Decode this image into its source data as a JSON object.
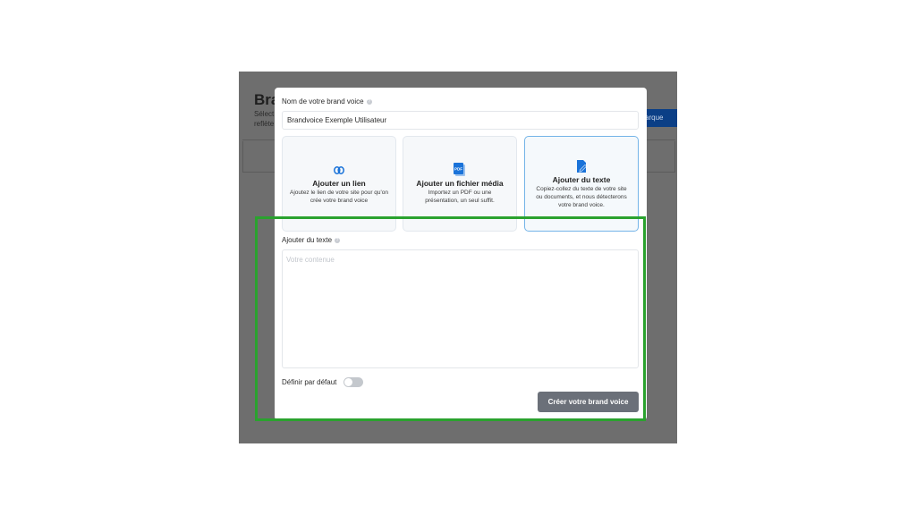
{
  "background": {
    "title": "Bra",
    "subtitle_line1": "Sélect",
    "subtitle_line2": "reflète",
    "button_label": "arque"
  },
  "modal": {
    "name_label": "Nom de votre brand voice",
    "name_value": "Brandvoice Exemple Utilisateur",
    "options": [
      {
        "title": "Ajouter un lien",
        "description": "Ajoutez le lien de votre site pour qu'on crée votre brand voice",
        "icon": "link-icon",
        "selected": false
      },
      {
        "title": "Ajouter un fichier média",
        "description": "Importez un PDF ou une présentation, un seul suffit.",
        "icon": "pdf-file-icon",
        "icon_text": "PDF",
        "selected": false
      },
      {
        "title": "Ajouter du texte",
        "description": "Copiez-collez du texte de votre site ou documents, et nous détecterons votre brand voice.",
        "icon": "edit-text-icon",
        "selected": true
      }
    ],
    "text_label": "Ajouter du texte",
    "text_placeholder": "Votre contenue",
    "default_label": "Définir par défaut",
    "default_toggle_on": false,
    "submit_label": "Créer votre brand voice",
    "info_glyph": "?"
  },
  "colors": {
    "accent": "#1a73d9",
    "highlight": "#2aa22e",
    "submit": "#6b7079",
    "selected_border": "#74b4e8"
  }
}
